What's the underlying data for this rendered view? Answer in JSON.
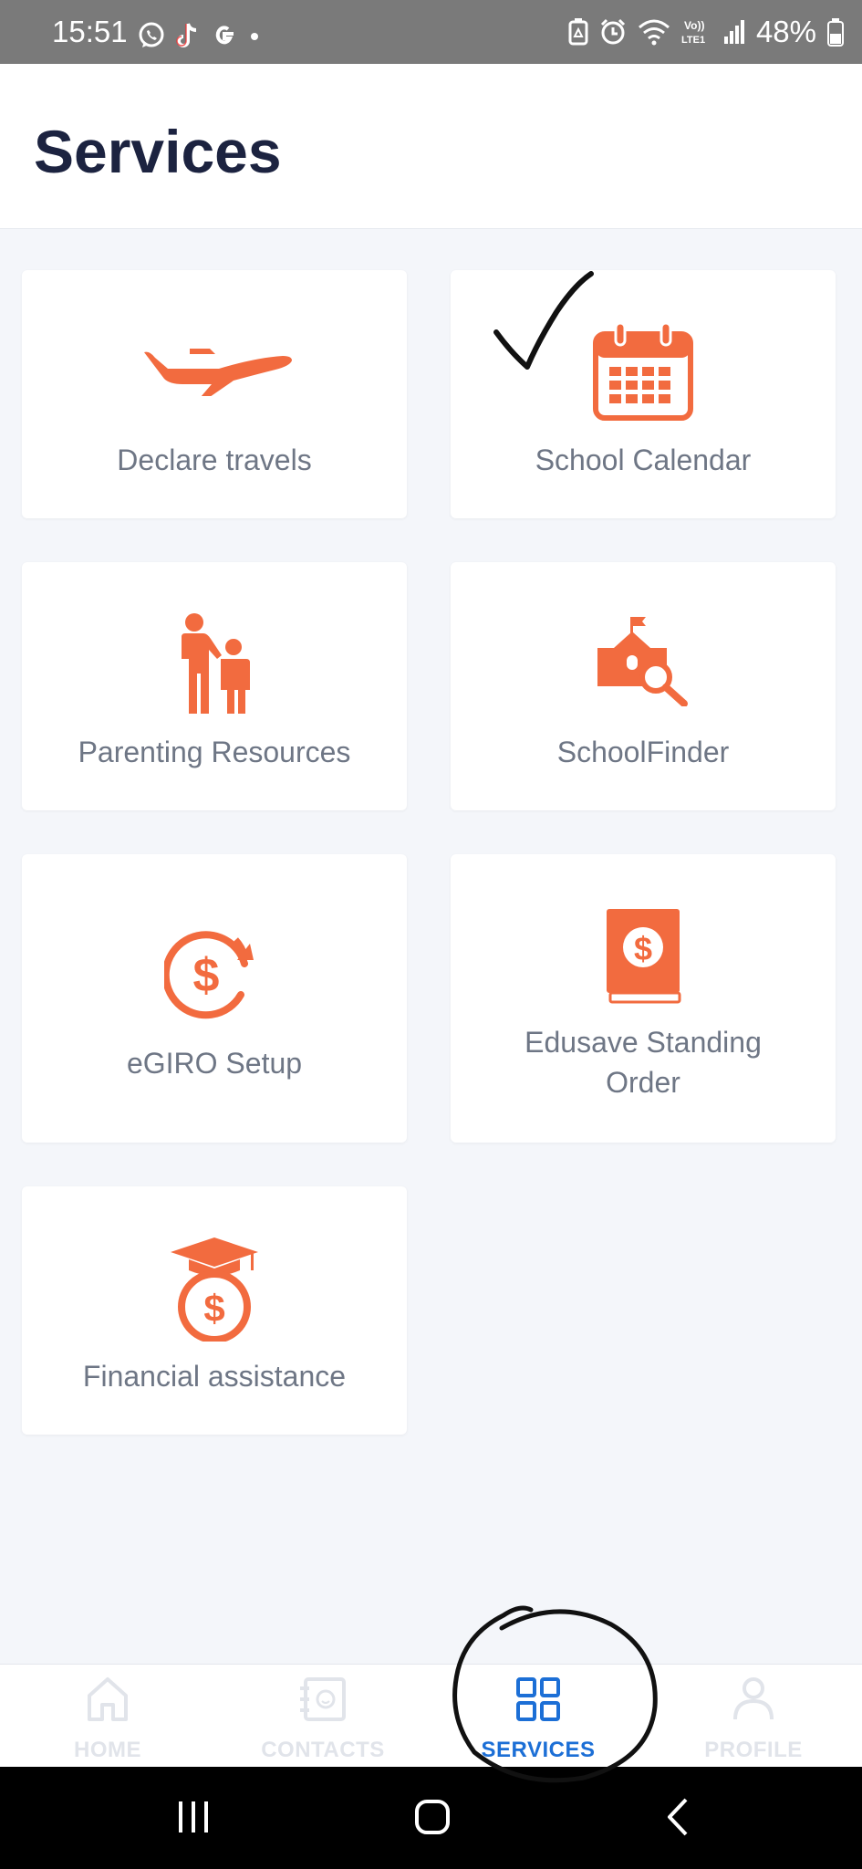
{
  "status_bar": {
    "time": "15:51",
    "battery": "48%",
    "icons": [
      "whatsapp-icon",
      "tiktok-icon",
      "google-icon",
      "notification-dot-icon",
      "battery-saver-icon",
      "alarm-icon",
      "wifi-icon",
      "volte-icon",
      "signal-icon",
      "battery-icon"
    ],
    "volte_text": "Vo))\nLTE1"
  },
  "header": {
    "title": "Services"
  },
  "services": [
    {
      "label": "Declare travels",
      "icon": "airplane-icon"
    },
    {
      "label": "School Calendar",
      "icon": "calendar-icon"
    },
    {
      "label": "Parenting Resources",
      "icon": "parent-child-icon"
    },
    {
      "label": "SchoolFinder",
      "icon": "school-search-icon"
    },
    {
      "label": "eGIRO Setup",
      "icon": "recurring-dollar-icon"
    },
    {
      "label": "Edusave Standing Order",
      "icon": "dollar-book-icon"
    },
    {
      "label": "Financial assistance",
      "icon": "graduation-money-bag-icon"
    }
  ],
  "bottom_nav": {
    "items": [
      {
        "label": "HOME",
        "icon": "home-icon",
        "active": false
      },
      {
        "label": "CONTACTS",
        "icon": "contacts-icon",
        "active": false
      },
      {
        "label": "SERVICES",
        "icon": "grid-icon",
        "active": true
      },
      {
        "label": "PROFILE",
        "icon": "profile-icon",
        "active": false
      }
    ]
  },
  "system_nav": {
    "buttons": [
      "recents-button",
      "home-button",
      "back-button"
    ]
  },
  "colors": {
    "accent": "#f26b3f",
    "title": "#1c2340",
    "label": "#6e7685",
    "active_nav": "#1c6fd6",
    "inactive_nav": "#e1e4ea",
    "background": "#f4f6fa",
    "status_bar": "#7a7a7a"
  },
  "annotations": [
    "handwritten-checkmark",
    "handwritten-circle-around-services"
  ]
}
